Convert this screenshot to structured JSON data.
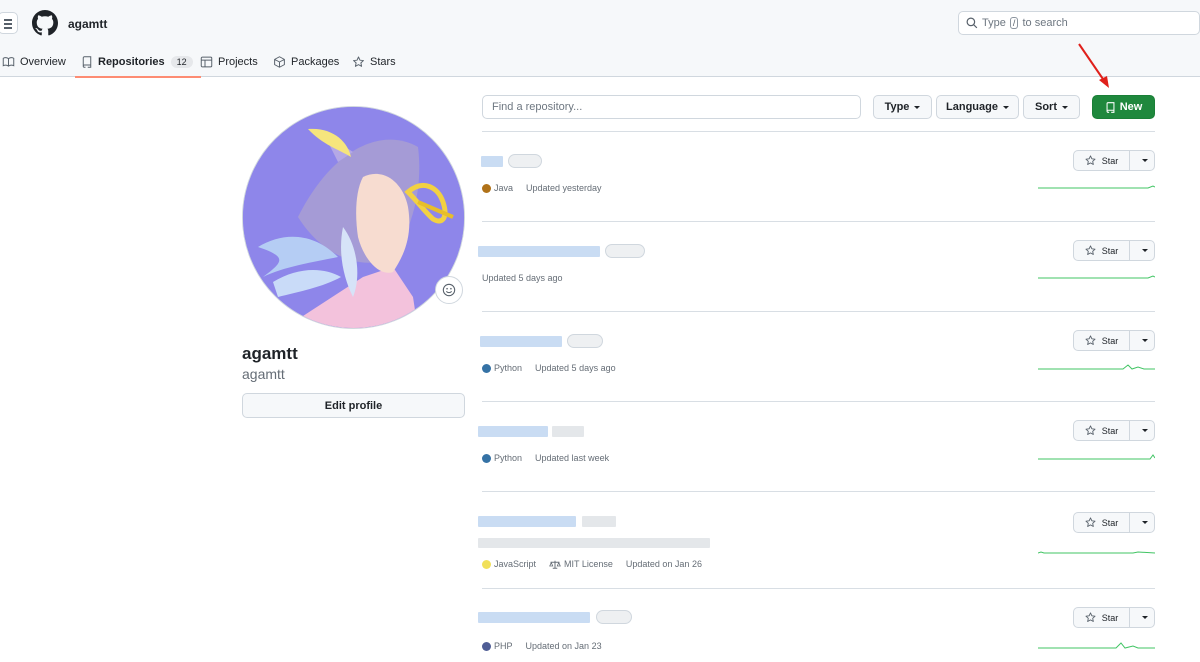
{
  "header": {
    "username": "agamtt",
    "search": {
      "prefix": "Type",
      "key": "/",
      "suffix": "to search"
    }
  },
  "tabs": [
    {
      "label": "Overview"
    },
    {
      "label": "Repositories",
      "count": "12",
      "selected": true
    },
    {
      "label": "Projects"
    },
    {
      "label": "Packages"
    },
    {
      "label": "Stars"
    }
  ],
  "profile": {
    "name": "agamtt",
    "login": "agamtt",
    "edit_label": "Edit profile"
  },
  "toolbar": {
    "find_placeholder": "Find a repository...",
    "type_label": "Type",
    "language_label": "Language",
    "sort_label": "Sort",
    "new_label": "New"
  },
  "repos": [
    {
      "language": "Java",
      "language_color": "#b07219",
      "updated": "Updated yesterday",
      "star_label": "Star"
    },
    {
      "language": "",
      "updated": "Updated 5 days ago",
      "star_label": "Star"
    },
    {
      "language": "Python",
      "language_color": "#3572A5",
      "updated": "Updated 5 days ago",
      "star_label": "Star"
    },
    {
      "language": "Python",
      "language_color": "#3572A5",
      "updated": "Updated last week",
      "star_label": "Star"
    },
    {
      "language": "JavaScript",
      "language_color": "#f1e05a",
      "license": "MIT License",
      "updated": "Updated on Jan 26",
      "star_label": "Star"
    },
    {
      "language": "PHP",
      "language_color": "#4F5D95",
      "updated": "Updated on Jan 23",
      "star_label": "Star"
    }
  ],
  "colors": {
    "primary_button": "#1f883d",
    "tab_underline": "#fd8c73",
    "annotation_arrow": "#e0201b",
    "sparkline": "#40c463"
  }
}
